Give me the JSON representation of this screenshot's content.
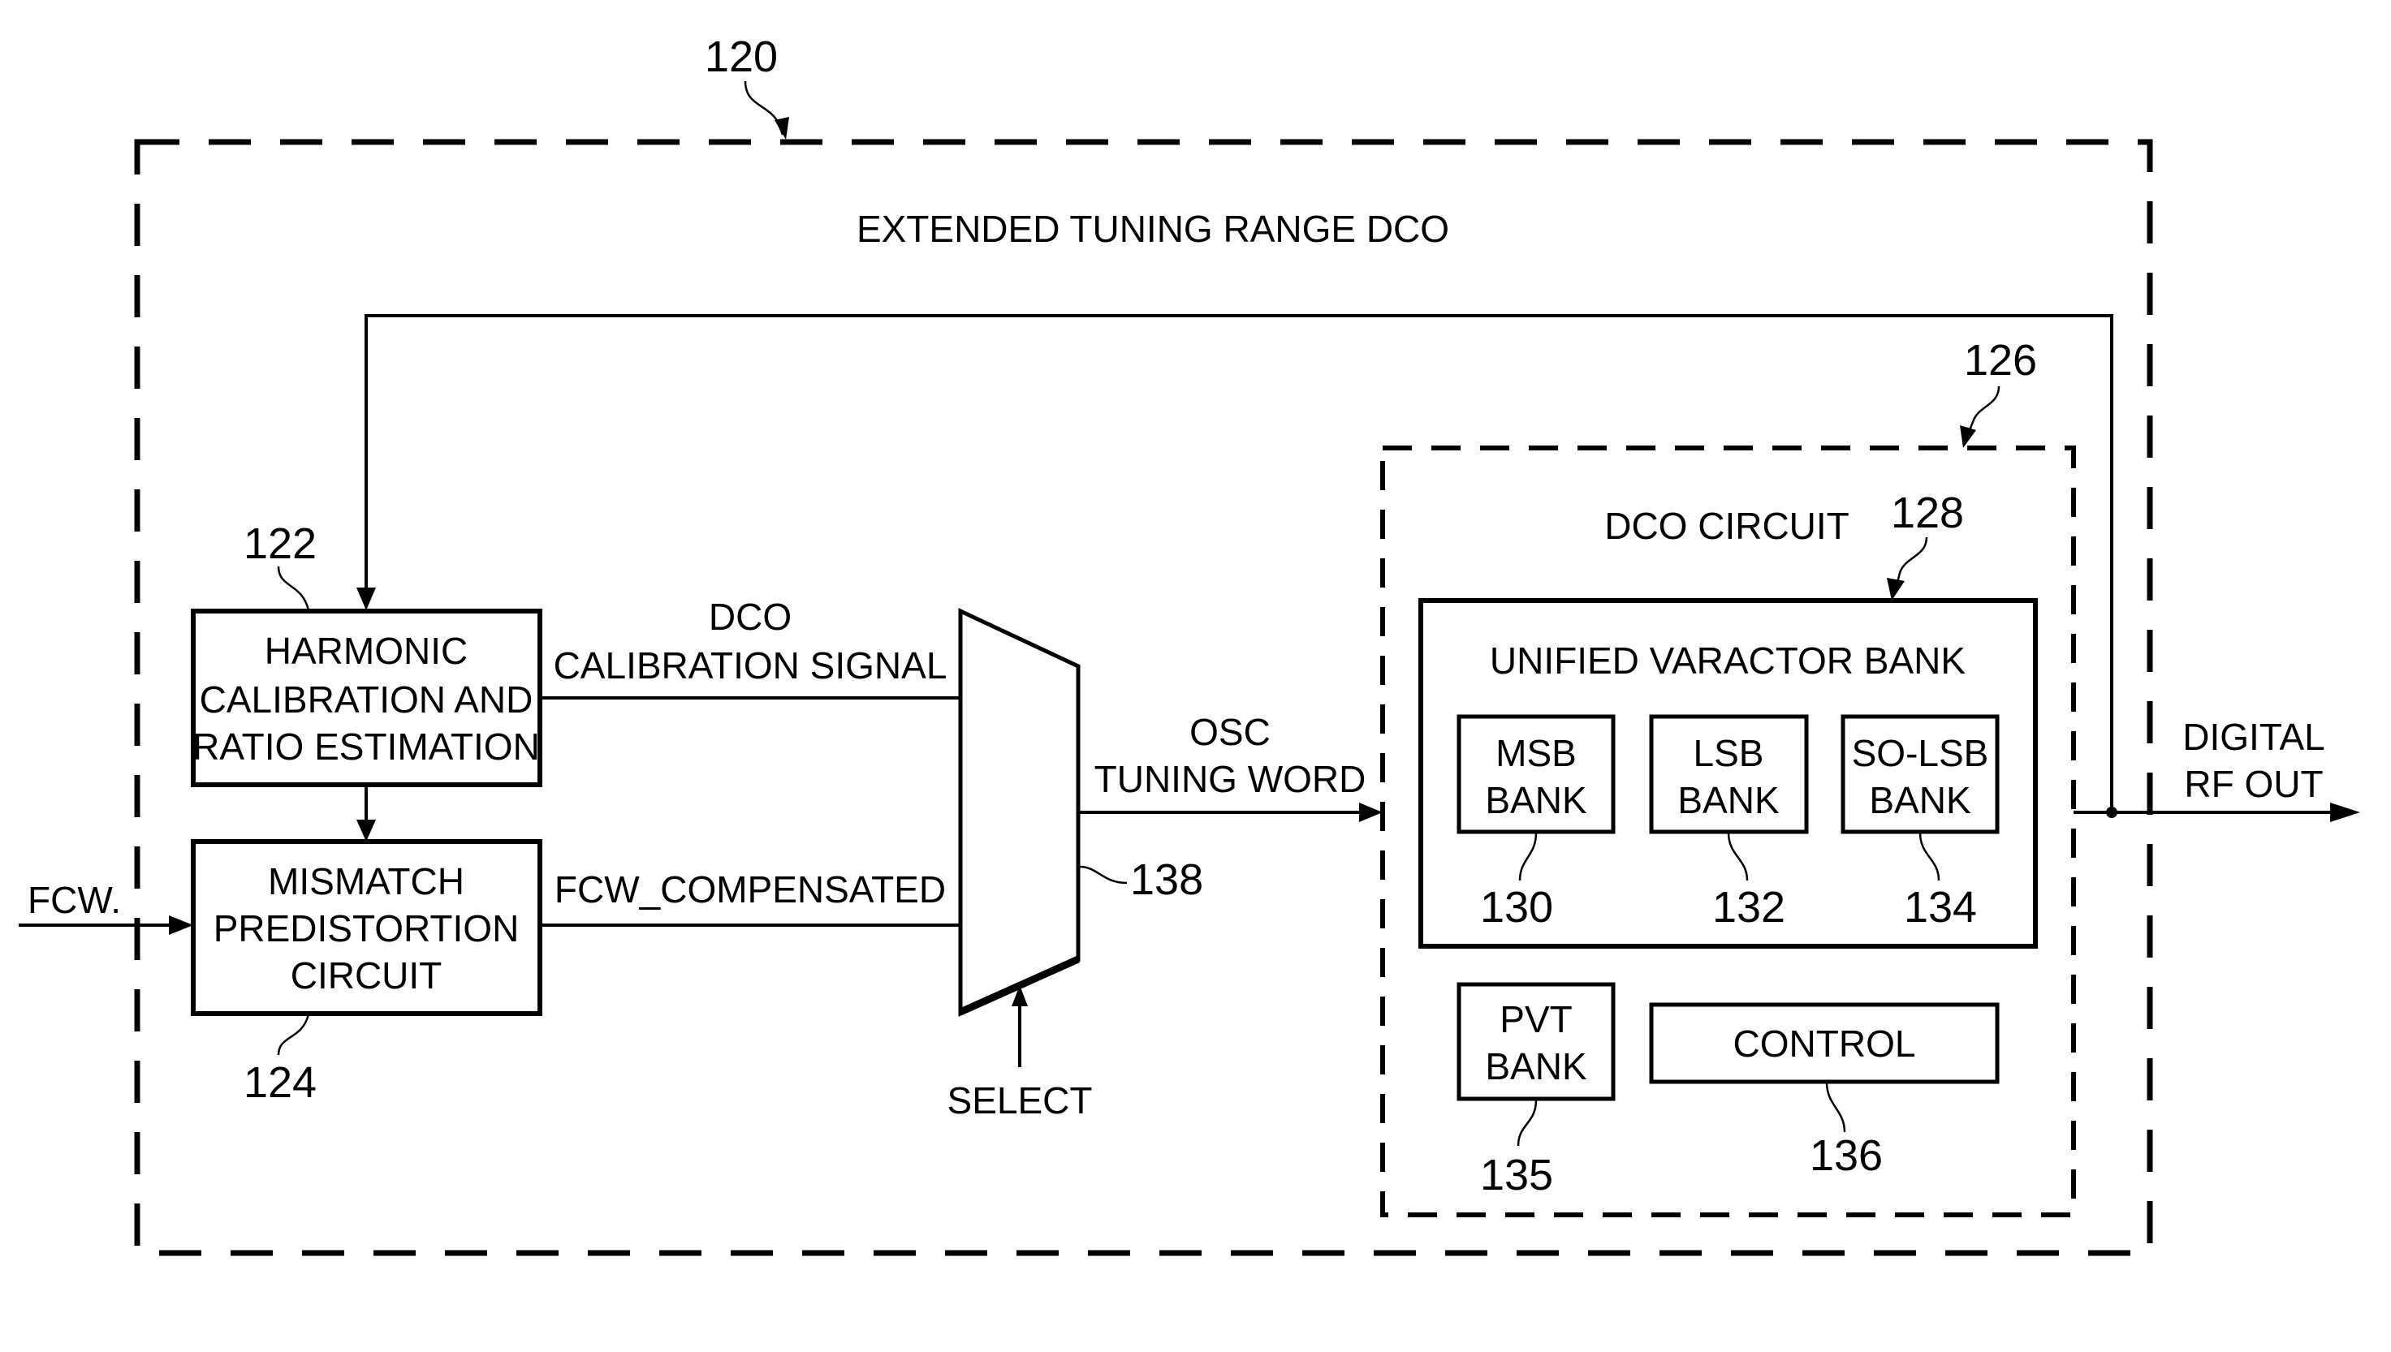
{
  "diagram": {
    "title": "EXTENDED TUNING RANGE DCO",
    "reference_numbers": {
      "outer": "120",
      "harmonic": "122",
      "mismatch": "124",
      "dco_circuit": "126",
      "unified_bank": "128",
      "msb": "130",
      "lsb": "132",
      "so_lsb": "134",
      "pvt": "135",
      "control": "136",
      "mux": "138"
    },
    "blocks": {
      "harmonic": [
        "HARMONIC",
        "CALIBRATION AND",
        "RATIO ESTIMATION"
      ],
      "mismatch": [
        "MISMATCH",
        "PREDISTORTION",
        "CIRCUIT"
      ],
      "dco_circuit": "DCO CIRCUIT",
      "unified_bank": "UNIFIED VARACTOR BANK",
      "msb": [
        "MSB",
        "BANK"
      ],
      "lsb": [
        "LSB",
        "BANK"
      ],
      "so_lsb": [
        "SO-LSB",
        "BANK"
      ],
      "pvt": [
        "PVT",
        "BANK"
      ],
      "control": "CONTROL"
    },
    "signals": {
      "fcw_input": "FCW.",
      "dco_cal": [
        "DCO",
        "CALIBRATION SIGNAL"
      ],
      "fcw_comp": "FCW_COMPENSATED",
      "osc_word": [
        "OSC",
        "TUNING WORD"
      ],
      "select": "SELECT",
      "output": [
        "DIGITAL",
        "RF OUT"
      ]
    }
  }
}
